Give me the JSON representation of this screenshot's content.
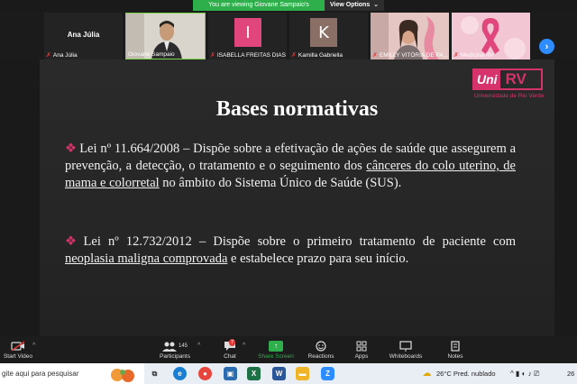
{
  "banner": {
    "text": "You are viewing Giovane Sampaio's screen",
    "view_options": "View Options",
    "chevron": "⌄"
  },
  "gallery": {
    "tiles": [
      {
        "name": "Ana Júlia",
        "label": "Ana Júlia"
      },
      {
        "label": "Giovane Sampaio"
      },
      {
        "initial": "I",
        "label": "ISABELLA FREITAS DIAS",
        "color": "#e0457b"
      },
      {
        "initial": "K",
        "label": "Kamilla Gabriella",
        "color": "#8a6f66"
      },
      {
        "label": "EMILLY VITÓRIA DE PA..."
      },
      {
        "label": "Medicina RV"
      }
    ]
  },
  "slide": {
    "title": "Bases normativas",
    "logo": {
      "uni": "Uni",
      "rv": "RV",
      "subtitle": "Universidade de Rio Verde"
    },
    "p1": {
      "start": "Lei nº 11.664/2008 – Dispõe sobre a efetivação de ações de saúde que assegurem a prevenção, a detecção, o tratamento e o seguimento dos ",
      "underlined": "cânceres do colo uterino, de mama e colorretal",
      "end": " no âmbito do Sistema Único de Saúde (SUS)."
    },
    "p2": {
      "start": "Lei nº 12.732/2012 – Dispõe sobre o primeiro tratamento de paciente com ",
      "underlined": "neoplasia maligna comprovada",
      "end": " e estabelece prazo para seu início."
    },
    "bullet": "❖"
  },
  "controls": {
    "start_video": "Start Video",
    "participants": "Participants",
    "participants_count": "145",
    "chat": "Chat",
    "chat_badge": "7",
    "share_screen": "Share Screen",
    "reactions": "Reactions",
    "apps": "Apps",
    "whiteboards": "Whiteboards",
    "notes": "Notes"
  },
  "taskbar": {
    "search_placeholder": "gite aqui para pesquisar",
    "weather": "26°C  Pred. nublado",
    "clock": "26"
  },
  "colors": {
    "accent": "#d6336c",
    "green": "#2fae4c",
    "blue": "#2d8cff"
  }
}
